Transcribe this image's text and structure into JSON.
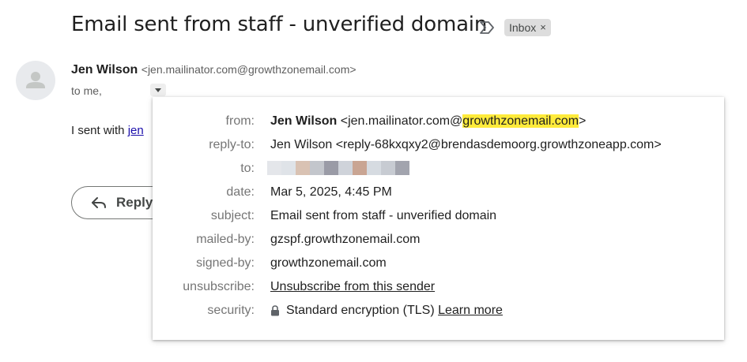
{
  "email": {
    "subject": "Email sent from staff - unverified domain",
    "label": "Inbox",
    "label_close": "×",
    "sender_name": "Jen Wilson",
    "sender_email": "<jen.mailinator.com@growthzonemail.com>",
    "to_line": "to me,",
    "body_prefix": "I sent with ",
    "body_link": "jen",
    "reply_label": "Reply"
  },
  "details": {
    "from": {
      "label": "from:",
      "name": "Jen Wilson",
      "addr_prefix": " <jen.mailinator.com@",
      "addr_domain": "growthzonemail.com",
      "addr_suffix": ">"
    },
    "reply_to": {
      "label": "reply-to:",
      "value": "Jen Wilson <reply-68kxqxy2@brendasdemoorg.growthzoneapp.com>"
    },
    "to": {
      "label": "to:",
      "redacted_colors": [
        "#e4e6ea",
        "#dfe3e8",
        "#d9c2b3",
        "#c3c6cc",
        "#9a9ba6",
        "#cfd3da",
        "#c9a593",
        "#d6dbe1",
        "#c7cbd2",
        "#a2a4ae"
      ]
    },
    "date": {
      "label": "date:",
      "value": "Mar 5, 2025, 4:45 PM"
    },
    "subject": {
      "label": "subject:",
      "value": "Email sent from staff - unverified domain"
    },
    "mailed_by": {
      "label": "mailed-by:",
      "value": "gzspf.growthzonemail.com"
    },
    "signed_by": {
      "label": "signed-by:",
      "value": "growthzonemail.com"
    },
    "unsubscribe": {
      "label": "unsubscribe:",
      "value": "Unsubscribe from this sender"
    },
    "security": {
      "label": "security:",
      "value": "Standard encryption (TLS)",
      "link": "Learn more",
      "icon": "lock-icon"
    }
  },
  "colors": {
    "highlight": "#ffeb3b",
    "link": "#1a0dab",
    "label_gray": "#757575"
  }
}
